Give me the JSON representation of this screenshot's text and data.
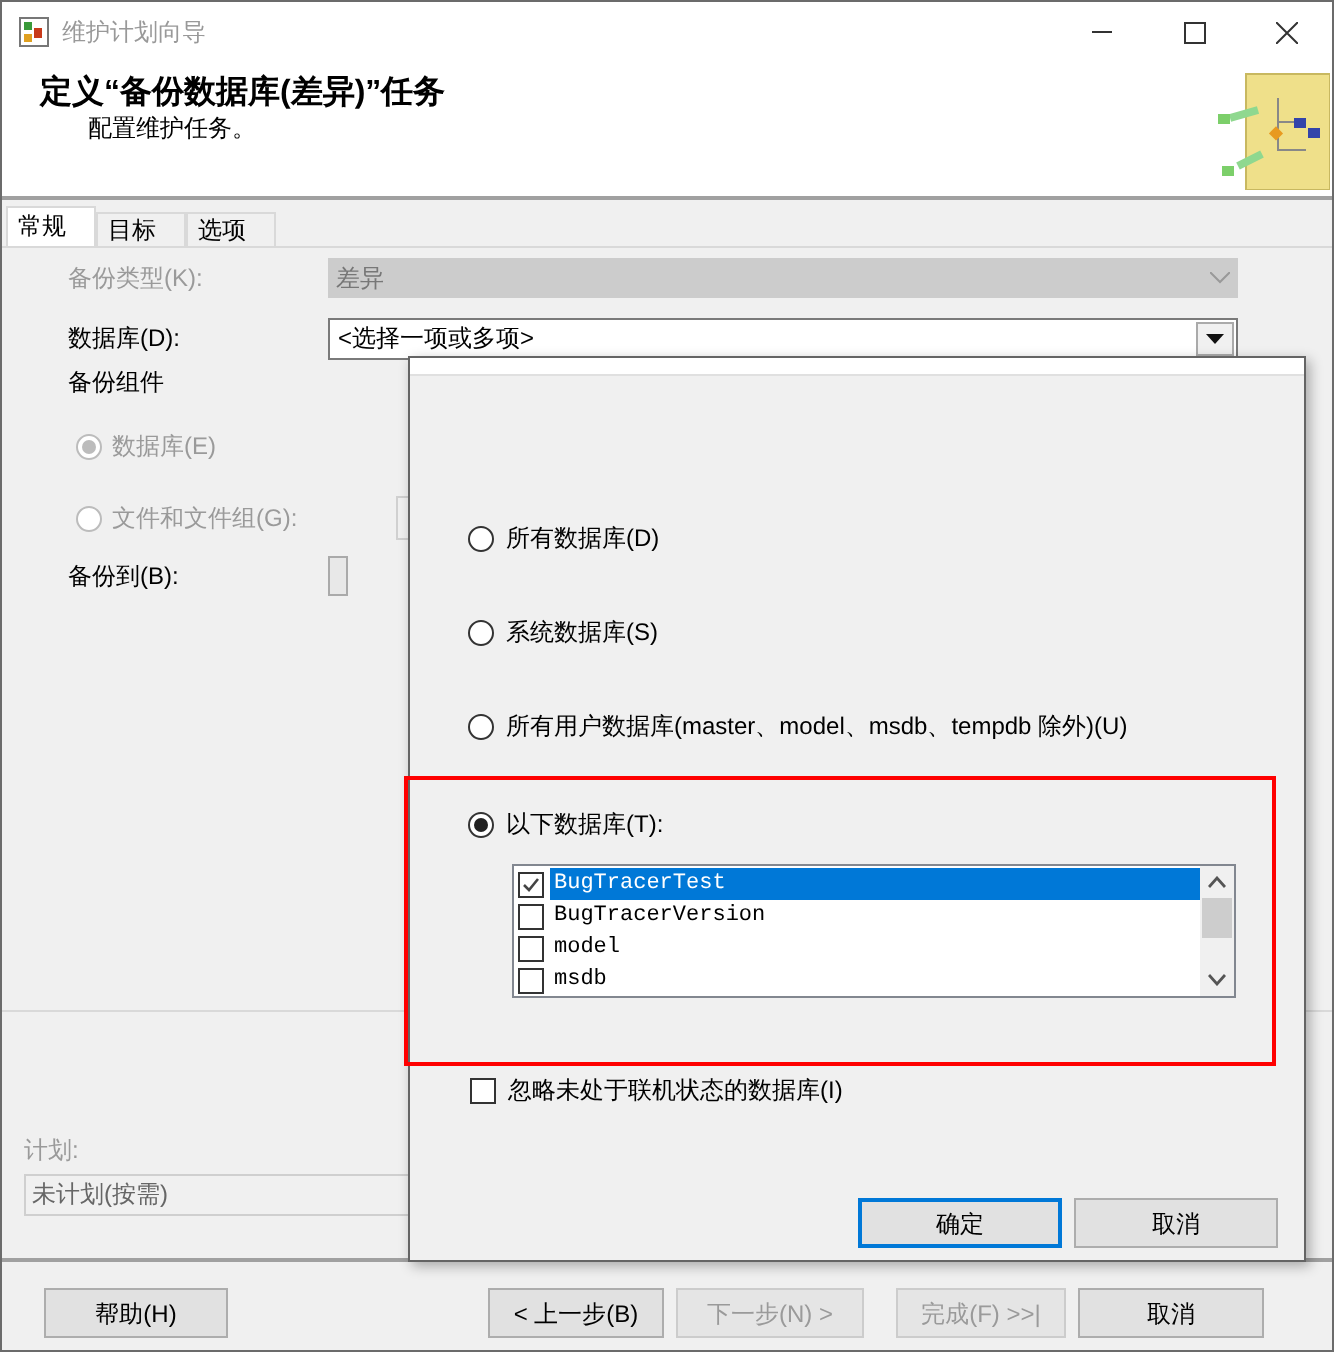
{
  "window": {
    "title": "维护计划向导"
  },
  "header": {
    "title": "定义“备份数据库(差异)”任务",
    "subtitle": "配置维护任务。"
  },
  "tabs": [
    {
      "label": "常规",
      "selected": true
    },
    {
      "label": "目标",
      "selected": false
    },
    {
      "label": "选项",
      "selected": false
    }
  ],
  "form": {
    "backup_type": {
      "label": "备份类型(K):",
      "value": "差异",
      "disabled": true
    },
    "database": {
      "label": "数据库(D):",
      "value": "<选择一项或多项>"
    },
    "components_label": "备份组件",
    "components": [
      {
        "label": "数据库(E)",
        "selected": true,
        "disabled": true
      },
      {
        "label": "文件和文件组(G):",
        "selected": false,
        "disabled": true
      }
    ],
    "backup_to": {
      "label": "备份到(B):"
    }
  },
  "schedule": {
    "label": "计划:",
    "value": "未计划(按需)",
    "disabled": true
  },
  "buttons": [
    {
      "label": "帮助(H)",
      "disabled": false
    },
    {
      "label": "< 上一步(B)",
      "disabled": false
    },
    {
      "label": "下一步(N) >",
      "disabled": true
    },
    {
      "label": "完成(F) >>|",
      "disabled": true
    },
    {
      "label": "取消",
      "disabled": false
    }
  ],
  "popup": {
    "options": [
      {
        "label": "所有数据库(D)",
        "selected": false,
        "highlighted": false
      },
      {
        "label": "系统数据库(S)",
        "selected": false,
        "highlighted": false
      },
      {
        "label": "所有用户数据库(master、model、msdb、tempdb 除外)(U)",
        "selected": false,
        "highlighted": false
      },
      {
        "label": "以下数据库(T):",
        "selected": true,
        "highlighted": true
      }
    ],
    "databases": [
      {
        "name": "BugTracerTest",
        "checked": true,
        "selected": true
      },
      {
        "name": "BugTracerVersion",
        "checked": false,
        "selected": false
      },
      {
        "name": "model",
        "checked": false,
        "selected": false
      },
      {
        "name": "msdb",
        "checked": false,
        "selected": false
      }
    ],
    "ignore_offline": {
      "label": "忽略未处于联机状态的数据库(I)",
      "checked": false
    },
    "buttons": [
      {
        "label": "确定",
        "default": true
      },
      {
        "label": "取消",
        "default": false
      }
    ]
  }
}
